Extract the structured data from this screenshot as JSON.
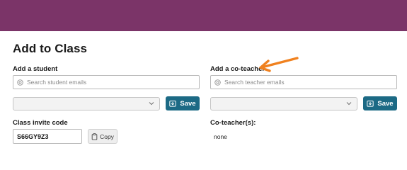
{
  "colors": {
    "header": "#7b3468",
    "primary_button": "#1c6a85",
    "arrow": "#f0811f"
  },
  "page": {
    "title": "Add to Class"
  },
  "student": {
    "label": "Add a student",
    "search_placeholder": "Search student emails",
    "search_icon": "at-sign-icon",
    "select_value": "",
    "save_label": "Save",
    "save_icon": "download-tray-icon"
  },
  "coteacher": {
    "label": "Add a co-teacher",
    "search_placeholder": "Search teacher emails",
    "search_icon": "at-sign-icon",
    "select_value": "",
    "save_label": "Save",
    "save_icon": "download-tray-icon"
  },
  "invite": {
    "label": "Class invite code",
    "code": "S66GY9Z3",
    "copy_label": "Copy",
    "copy_icon": "clipboard-icon"
  },
  "coteachers_list": {
    "label": "Co-teacher(s):",
    "value": "none"
  },
  "annotation": {
    "icon": "orange-arrow-icon"
  }
}
